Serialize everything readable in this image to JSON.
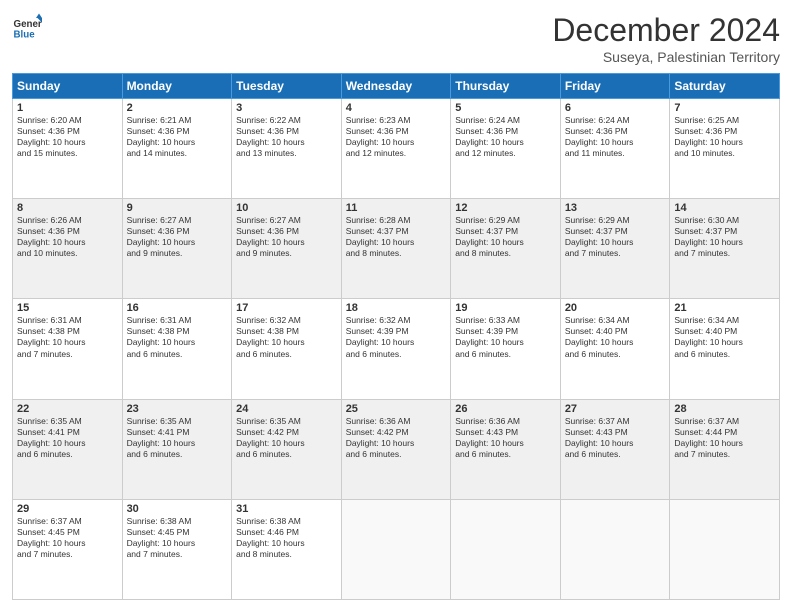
{
  "header": {
    "title": "December 2024",
    "subtitle": "Suseya, Palestinian Territory"
  },
  "columns": [
    "Sunday",
    "Monday",
    "Tuesday",
    "Wednesday",
    "Thursday",
    "Friday",
    "Saturday"
  ],
  "weeks": [
    [
      {
        "day": "1",
        "info": "Sunrise: 6:20 AM\nSunset: 4:36 PM\nDaylight: 10 hours\nand 15 minutes."
      },
      {
        "day": "2",
        "info": "Sunrise: 6:21 AM\nSunset: 4:36 PM\nDaylight: 10 hours\nand 14 minutes."
      },
      {
        "day": "3",
        "info": "Sunrise: 6:22 AM\nSunset: 4:36 PM\nDaylight: 10 hours\nand 13 minutes."
      },
      {
        "day": "4",
        "info": "Sunrise: 6:23 AM\nSunset: 4:36 PM\nDaylight: 10 hours\nand 12 minutes."
      },
      {
        "day": "5",
        "info": "Sunrise: 6:24 AM\nSunset: 4:36 PM\nDaylight: 10 hours\nand 12 minutes."
      },
      {
        "day": "6",
        "info": "Sunrise: 6:24 AM\nSunset: 4:36 PM\nDaylight: 10 hours\nand 11 minutes."
      },
      {
        "day": "7",
        "info": "Sunrise: 6:25 AM\nSunset: 4:36 PM\nDaylight: 10 hours\nand 10 minutes."
      }
    ],
    [
      {
        "day": "8",
        "info": "Sunrise: 6:26 AM\nSunset: 4:36 PM\nDaylight: 10 hours\nand 10 minutes."
      },
      {
        "day": "9",
        "info": "Sunrise: 6:27 AM\nSunset: 4:36 PM\nDaylight: 10 hours\nand 9 minutes."
      },
      {
        "day": "10",
        "info": "Sunrise: 6:27 AM\nSunset: 4:36 PM\nDaylight: 10 hours\nand 9 minutes."
      },
      {
        "day": "11",
        "info": "Sunrise: 6:28 AM\nSunset: 4:37 PM\nDaylight: 10 hours\nand 8 minutes."
      },
      {
        "day": "12",
        "info": "Sunrise: 6:29 AM\nSunset: 4:37 PM\nDaylight: 10 hours\nand 8 minutes."
      },
      {
        "day": "13",
        "info": "Sunrise: 6:29 AM\nSunset: 4:37 PM\nDaylight: 10 hours\nand 7 minutes."
      },
      {
        "day": "14",
        "info": "Sunrise: 6:30 AM\nSunset: 4:37 PM\nDaylight: 10 hours\nand 7 minutes."
      }
    ],
    [
      {
        "day": "15",
        "info": "Sunrise: 6:31 AM\nSunset: 4:38 PM\nDaylight: 10 hours\nand 7 minutes."
      },
      {
        "day": "16",
        "info": "Sunrise: 6:31 AM\nSunset: 4:38 PM\nDaylight: 10 hours\nand 6 minutes."
      },
      {
        "day": "17",
        "info": "Sunrise: 6:32 AM\nSunset: 4:38 PM\nDaylight: 10 hours\nand 6 minutes."
      },
      {
        "day": "18",
        "info": "Sunrise: 6:32 AM\nSunset: 4:39 PM\nDaylight: 10 hours\nand 6 minutes."
      },
      {
        "day": "19",
        "info": "Sunrise: 6:33 AM\nSunset: 4:39 PM\nDaylight: 10 hours\nand 6 minutes."
      },
      {
        "day": "20",
        "info": "Sunrise: 6:34 AM\nSunset: 4:40 PM\nDaylight: 10 hours\nand 6 minutes."
      },
      {
        "day": "21",
        "info": "Sunrise: 6:34 AM\nSunset: 4:40 PM\nDaylight: 10 hours\nand 6 minutes."
      }
    ],
    [
      {
        "day": "22",
        "info": "Sunrise: 6:35 AM\nSunset: 4:41 PM\nDaylight: 10 hours\nand 6 minutes."
      },
      {
        "day": "23",
        "info": "Sunrise: 6:35 AM\nSunset: 4:41 PM\nDaylight: 10 hours\nand 6 minutes."
      },
      {
        "day": "24",
        "info": "Sunrise: 6:35 AM\nSunset: 4:42 PM\nDaylight: 10 hours\nand 6 minutes."
      },
      {
        "day": "25",
        "info": "Sunrise: 6:36 AM\nSunset: 4:42 PM\nDaylight: 10 hours\nand 6 minutes."
      },
      {
        "day": "26",
        "info": "Sunrise: 6:36 AM\nSunset: 4:43 PM\nDaylight: 10 hours\nand 6 minutes."
      },
      {
        "day": "27",
        "info": "Sunrise: 6:37 AM\nSunset: 4:43 PM\nDaylight: 10 hours\nand 6 minutes."
      },
      {
        "day": "28",
        "info": "Sunrise: 6:37 AM\nSunset: 4:44 PM\nDaylight: 10 hours\nand 7 minutes."
      }
    ],
    [
      {
        "day": "29",
        "info": "Sunrise: 6:37 AM\nSunset: 4:45 PM\nDaylight: 10 hours\nand 7 minutes."
      },
      {
        "day": "30",
        "info": "Sunrise: 6:38 AM\nSunset: 4:45 PM\nDaylight: 10 hours\nand 7 minutes."
      },
      {
        "day": "31",
        "info": "Sunrise: 6:38 AM\nSunset: 4:46 PM\nDaylight: 10 hours\nand 8 minutes."
      },
      {
        "day": "",
        "info": ""
      },
      {
        "day": "",
        "info": ""
      },
      {
        "day": "",
        "info": ""
      },
      {
        "day": "",
        "info": ""
      }
    ]
  ]
}
